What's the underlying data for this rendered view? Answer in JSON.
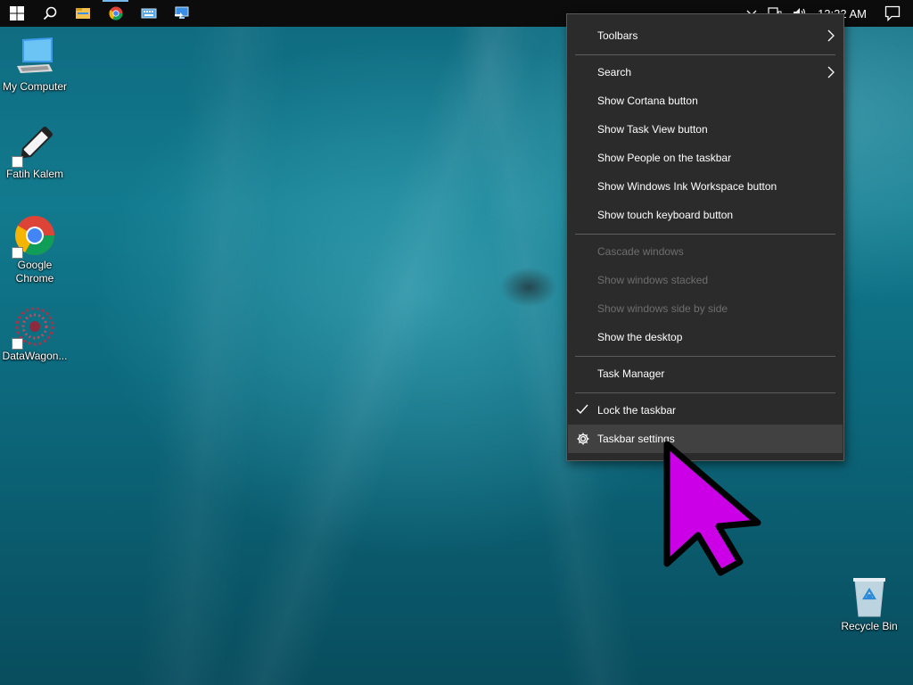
{
  "desktop": {
    "icons": [
      {
        "label": "My Computer",
        "icon": "my-computer-icon"
      },
      {
        "label": "Fatih Kalem",
        "icon": "fatih-kalem-icon"
      },
      {
        "label": "Google Chrome",
        "label_line1": "Google",
        "label_line2": "Chrome",
        "icon": "chrome-icon"
      },
      {
        "label": "DataWagon...",
        "icon": "datawagon-icon"
      },
      {
        "label": "Recycle Bin",
        "icon": "recycle-bin-icon"
      }
    ]
  },
  "taskbar": {
    "buttons": [
      "windows-start-icon",
      "search-icon",
      "file-explorer-icon",
      "chrome-icon",
      "keyboard-icon",
      "remote-desktop-icon"
    ],
    "clock": "12:22 AM",
    "tray_icons": [
      "chevron-up-icon",
      "network-icon",
      "volume-icon",
      "notifications-icon"
    ]
  },
  "context_menu": {
    "items": [
      {
        "label": "Toolbars",
        "submenu": true
      },
      {
        "label": "Search",
        "submenu": true
      },
      {
        "label": "Show Cortana button"
      },
      {
        "label": "Show Task View button"
      },
      {
        "label": "Show People on the taskbar"
      },
      {
        "label": "Show Windows Ink Workspace button"
      },
      {
        "label": "Show touch keyboard button"
      },
      {
        "label": "Cascade windows",
        "disabled": true
      },
      {
        "label": "Show windows stacked",
        "disabled": true
      },
      {
        "label": "Show windows side by side",
        "disabled": true
      },
      {
        "label": "Show the desktop"
      },
      {
        "label": "Task Manager"
      },
      {
        "label": "Lock the taskbar",
        "checked": true
      },
      {
        "label": "Taskbar settings",
        "icon": "gear-icon",
        "highlighted": true
      }
    ]
  },
  "colors": {
    "menu_bg": "#2b2b2b",
    "menu_hover": "#414141",
    "taskbar_bg": "#0c0c0d",
    "cursor_fill": "#cc00e6"
  }
}
